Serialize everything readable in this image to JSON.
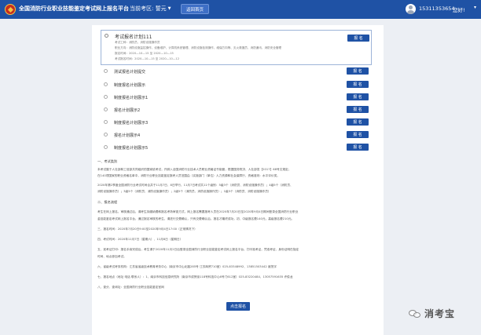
{
  "header": {
    "site_title": "全国消防行业职业技能鉴定考试网上报名平台",
    "exam_area_label": "当前考区: 誓元",
    "back_button": "返回首页",
    "phone": "15311353654",
    "greeting": "您好!",
    "colors": {
      "topbar": "#1f52a5"
    }
  },
  "selected_plan": {
    "title": "考试报名计划111",
    "details": [
      "考试工种：消防员、消防设施操作员",
      "职业方向：消防设施监控操作、设备维护、计算机系统管理、消防设施检测操作、维保方向等、灭火救援员、消防通讯、消防安全管理",
      "报名时间：2020—10—15 至 2020—10—15",
      "考试报名时间：2020—10—15 至 2020—10—12"
    ],
    "apply_label": "报 名"
  },
  "plans": [
    {
      "name": "测试报名计划提交",
      "apply_label": "报 名"
    },
    {
      "name": "制度报名计划展示",
      "apply_label": "报 名"
    },
    {
      "name": "制度报名计划展示1",
      "apply_label": "报 名"
    },
    {
      "name": "报名计划展示2",
      "apply_label": "报 名"
    },
    {
      "name": "制度报名计划展示3",
      "apply_label": "报 名"
    },
    {
      "name": "报名计划展示4",
      "apply_label": "报 名"
    },
    {
      "name": "制度报名计划展示5",
      "apply_label": "报 名"
    }
  ],
  "notes": {
    "lines": [
      {
        "text": "一、考试类别",
        "head": true
      },
      {
        "text": "本考试属于人社部和工信部共同组织的国家统考试，开辟入全国消防行业技术人员职业资格证书制度，根据国务院决、人社部发【2017】68号文规定，"
      },
      {
        "text": "在140项国家的职业资格名单中，消防行业职业技能鉴定报考人员范围由（实施部门（单位）人力资源和社会保障厅，资格准则：水平评价类。"
      },
      {
        "text": "2020年第2季度全国消防行业考试时间合并于11月7日、8日举行，11月7日考试共11个级别：5级3个（消防员、消防设施操作员）；4级5个（消防员、"
      },
      {
        "text": "消防设施操作员）；3级5个（消防员、消防设施操作员）；2级5个（消防员、消防设施操作员）；1级5个（消防员、消防设施操作员）"
      },
      {
        "text": "二、报名流程",
        "head": true
      },
      {
        "text": "考生在网上报名，审核通过后，请考生持缴纳费和报名考场审查方式，网上报名需要报考人员在2020年7月20日至2020年9月4日期间登录全国消防行业职业"
      },
      {
        "text": "金技能鉴定考试网上报名平台，通过报名审核的考生，请进行交费确认，只有交费确认后，报名才最终成功，初、中级报名费140元，高级报名费210元。"
      },
      {
        "text": "三、报名时间：2020年7月20日9:00至2020年9月4日17:00（正常情况下）"
      },
      {
        "text": "四、考试时间：2020年11月7日（星期六）、11月8日（星期日）"
      },
      {
        "text": "五、准考证打印：报名手续完成后，考生请于2020年11月2日后登录全国消防行业职业技能鉴定考试网上报名平台，打印准考证，凭准考证、身份证明在指定"
      },
      {
        "text": "时间、地点参加考试。"
      },
      {
        "text": "六、省级考试考务机构：江苏省省级技术教育考务中心（南京市中山北路285号 江苏商贸710室）025-83348992、13851503442 谢茂宇"
      },
      {
        "text": "七、报名地点（地址 电话 联系人）：1、南京市科技信息研究所（南京市成贤街118号科技中心6号门612室）025-83220484、13057591635 许俊龙"
      },
      {
        "text": "八、查分、查询址：全国消防行业职业技能鉴定官网"
      }
    ]
  },
  "submit_label": "点击报名",
  "watermark": {
    "text": "消考宝",
    "icon": "wechat-icon"
  }
}
